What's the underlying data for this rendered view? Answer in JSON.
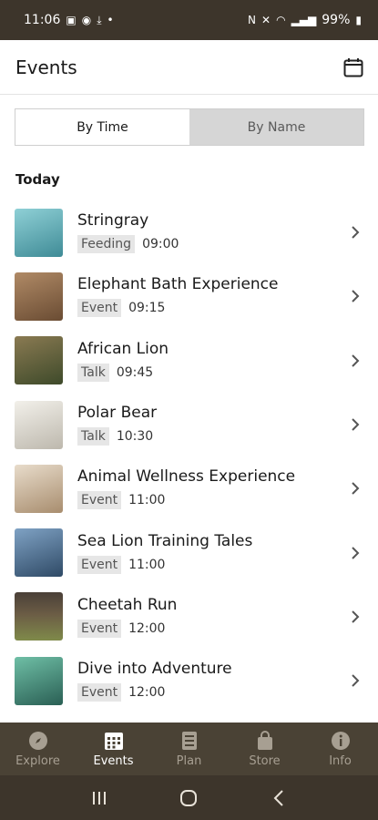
{
  "status_bar": {
    "time": "11:06",
    "battery": "99%"
  },
  "header": {
    "title": "Events"
  },
  "tabs": [
    {
      "label": "By Time",
      "active": true
    },
    {
      "label": "By Name",
      "active": false
    }
  ],
  "section": {
    "title": "Today"
  },
  "events": [
    {
      "name": "Stringray",
      "tag": "Feeding",
      "time": "09:00",
      "thumb_color": "#5fa9b3"
    },
    {
      "name": "Elephant Bath Experience",
      "tag": "Event",
      "time": "09:15",
      "thumb_color": "#8c6a4b"
    },
    {
      "name": "African Lion",
      "tag": "Talk",
      "time": "09:45",
      "thumb_color": "#6b5a3a"
    },
    {
      "name": "Polar Bear",
      "tag": "Talk",
      "time": "10:30",
      "thumb_color": "#d9d6cf"
    },
    {
      "name": "Animal Wellness Experience",
      "tag": "Event",
      "time": "11:00",
      "thumb_color": "#c9b39a"
    },
    {
      "name": "Sea Lion Training Tales",
      "tag": "Event",
      "time": "11:00",
      "thumb_color": "#4d6f8f"
    },
    {
      "name": "Cheetah Run",
      "tag": "Event",
      "time": "12:00",
      "thumb_color": "#7a6a4a"
    },
    {
      "name": "Dive into Adventure",
      "tag": "Event",
      "time": "12:00",
      "thumb_color": "#3f8f7a"
    }
  ],
  "bottom_nav": [
    {
      "label": "Explore",
      "icon": "compass-icon",
      "active": false
    },
    {
      "label": "Events",
      "icon": "calendar-grid-icon",
      "active": true
    },
    {
      "label": "Plan",
      "icon": "plan-icon",
      "active": false
    },
    {
      "label": "Store",
      "icon": "bag-icon",
      "active": false
    },
    {
      "label": "Info",
      "icon": "info-icon",
      "active": false
    }
  ],
  "colors": {
    "nav_bg": "#4a4235",
    "status_bg": "#3d352b",
    "active_tab_bg": "#ffffff",
    "inactive_tab_bg": "#d6d6d6"
  }
}
